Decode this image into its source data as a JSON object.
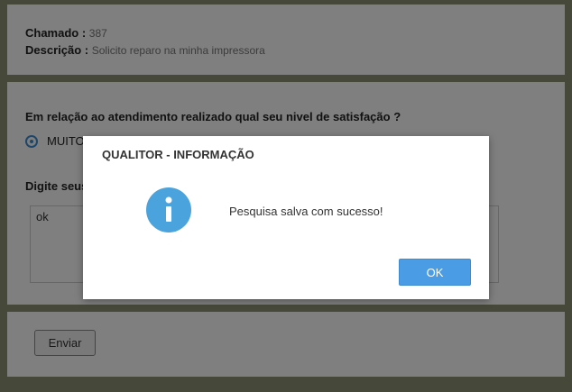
{
  "ticket": {
    "number_label": "Chamado :",
    "number_value": "387",
    "description_label": "Descrição :",
    "description_value": "Solicito reparo na minha impressora"
  },
  "survey": {
    "question": "Em relação ao atendimento realizado qual seu nivel de satisfação ?",
    "selected_option": "MUITO",
    "comment_label": "Digite seus",
    "comment_value": "ok"
  },
  "actions": {
    "send_label": "Enviar"
  },
  "dialog": {
    "title": "QUALITOR - INFORMAÇÃO",
    "message": "Pesquisa salva com sucesso!",
    "ok_label": "OK",
    "icon": "info-icon",
    "icon_color": "#4aa3dc"
  }
}
